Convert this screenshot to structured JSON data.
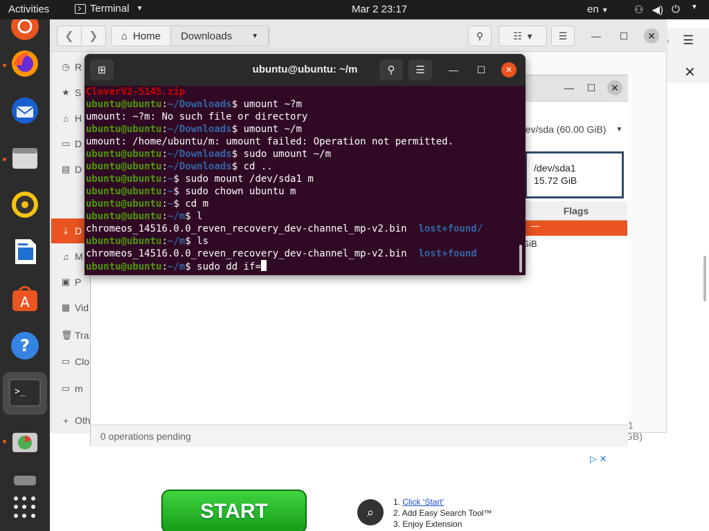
{
  "topbar": {
    "activities": "Activities",
    "app_name": "Terminal",
    "clock": "Mar 2  23:17",
    "lang": "en"
  },
  "dock": {
    "apps": [
      "ubuntu-icon",
      "firefox-icon",
      "thunderbird-icon",
      "files-icon",
      "rhythmbox-icon",
      "writer-icon",
      "software-icon",
      "help-icon",
      "terminal-icon",
      "gparted-icon",
      "drive-icon"
    ]
  },
  "files": {
    "path": [
      "Home",
      "Downloads"
    ],
    "sidebar": [
      {
        "label": "R",
        "icon": "clock-icon"
      },
      {
        "label": "S",
        "icon": "star-icon"
      },
      {
        "label": "H",
        "icon": "home-icon"
      },
      {
        "label": "D",
        "icon": "desktop-icon"
      },
      {
        "label": "D",
        "icon": "documents-icon"
      },
      {
        "label": "D",
        "icon": "downloads-icon"
      },
      {
        "label": "M",
        "icon": "music-icon"
      },
      {
        "label": "P",
        "icon": "pictures-icon"
      },
      {
        "label": "Vid",
        "icon": "video-icon"
      },
      {
        "label": "Tra",
        "icon": "trash-icon"
      },
      {
        "label": "Clo",
        "icon": "drive-icon"
      },
      {
        "label": "m",
        "icon": "drive-icon"
      },
      {
        "label": "Oth",
        "icon": "plus-icon"
      }
    ]
  },
  "gparted": {
    "device": "/dev/sda (60.00 GiB)",
    "partition_name": "/dev/sda1",
    "partition_size": "15.72 GiB",
    "col_flags": "Flags",
    "sel_row": "—",
    "frag_gib": "GiB",
    "frag_total": ".1 GB)",
    "status": "0 operations pending"
  },
  "terminal": {
    "title": "ubuntu@ubuntu: ~/m",
    "user": "ubuntu@ubuntu",
    "lines": [
      {
        "type": "plain",
        "text": "CloverV2-5145.zip"
      },
      {
        "type": "prompt",
        "path": "~/Downloads",
        "cmd": " umount ~?m"
      },
      {
        "type": "plain",
        "text": "umount: ~?m: No such file or directory"
      },
      {
        "type": "prompt",
        "path": "~/Downloads",
        "cmd": " umount ~/m"
      },
      {
        "type": "plain",
        "text": "umount: /home/ubuntu/m: umount failed: Operation not permitted."
      },
      {
        "type": "prompt",
        "path": "~/Downloads",
        "cmd": " sudo umount ~/m"
      },
      {
        "type": "prompt",
        "path": "~/Downloads",
        "cmd": " cd .."
      },
      {
        "type": "prompt",
        "path": "~",
        "cmd": " sudo mount /dev/sda1 m"
      },
      {
        "type": "prompt",
        "path": "~",
        "cmd": " sudo chown ubuntu m"
      },
      {
        "type": "prompt",
        "path": "~",
        "cmd": " cd m"
      },
      {
        "type": "prompt",
        "path": "~/m",
        "cmd": " l"
      },
      {
        "type": "listing",
        "file": "chromeos_14516.0.0_reven_recovery_dev-channel_mp-v2.bin",
        "dir": "lost+found/"
      },
      {
        "type": "prompt",
        "path": "~/m",
        "cmd": " ls"
      },
      {
        "type": "listing",
        "file": "chromeos_14516.0.0_reven_recovery_dev-channel_mp-v2.bin",
        "dir": "lost+found"
      },
      {
        "type": "prompt",
        "path": "~/m",
        "cmd": " sudo dd if="
      }
    ]
  },
  "ad": {
    "start": "START",
    "step1_prefix": "1. ",
    "step1_link": "Click ‘Start’",
    "step2": "2. Add Easy Search Tool™",
    "step3": "3. Enjoy Extension"
  },
  "colors": {
    "accent": "#e95420",
    "terminal_bg": "#300a24",
    "prompt_user": "#4e9a06",
    "prompt_path": "#3465a4"
  }
}
